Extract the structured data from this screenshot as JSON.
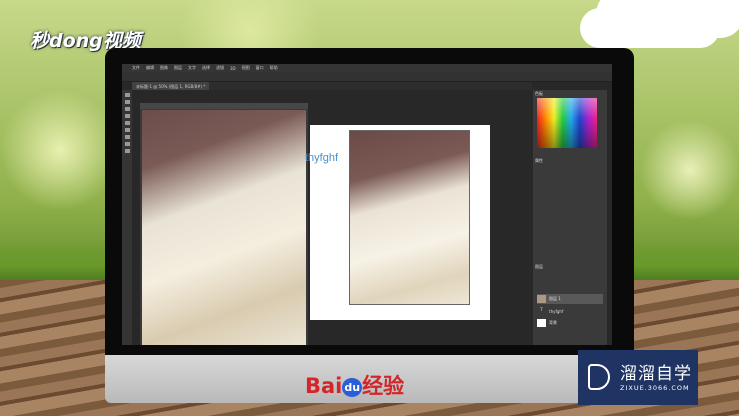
{
  "brand": {
    "top_left": "秒dong视频",
    "bottom_logo": "溜溜自学",
    "bottom_logo_url": "ZIXUE.3066.COM"
  },
  "baidu": {
    "bai": "Bai",
    "du": "du",
    "jingyan": "经验"
  },
  "photoshop": {
    "menu": [
      "文件",
      "编辑",
      "图像",
      "图层",
      "文字",
      "选择",
      "滤镜",
      "3D",
      "视图",
      "窗口",
      "帮助"
    ],
    "tab": "未标题-1 @ 50% (图层 1, RGB/8#) *",
    "canvas_text": "thyfghf",
    "panels": {
      "swatches": "色板",
      "properties": "属性",
      "layers": "图层"
    },
    "layers": [
      {
        "name": "图层 1",
        "selected": true
      },
      {
        "name": "thyfghf",
        "type": "text"
      },
      {
        "name": "背景"
      }
    ]
  }
}
